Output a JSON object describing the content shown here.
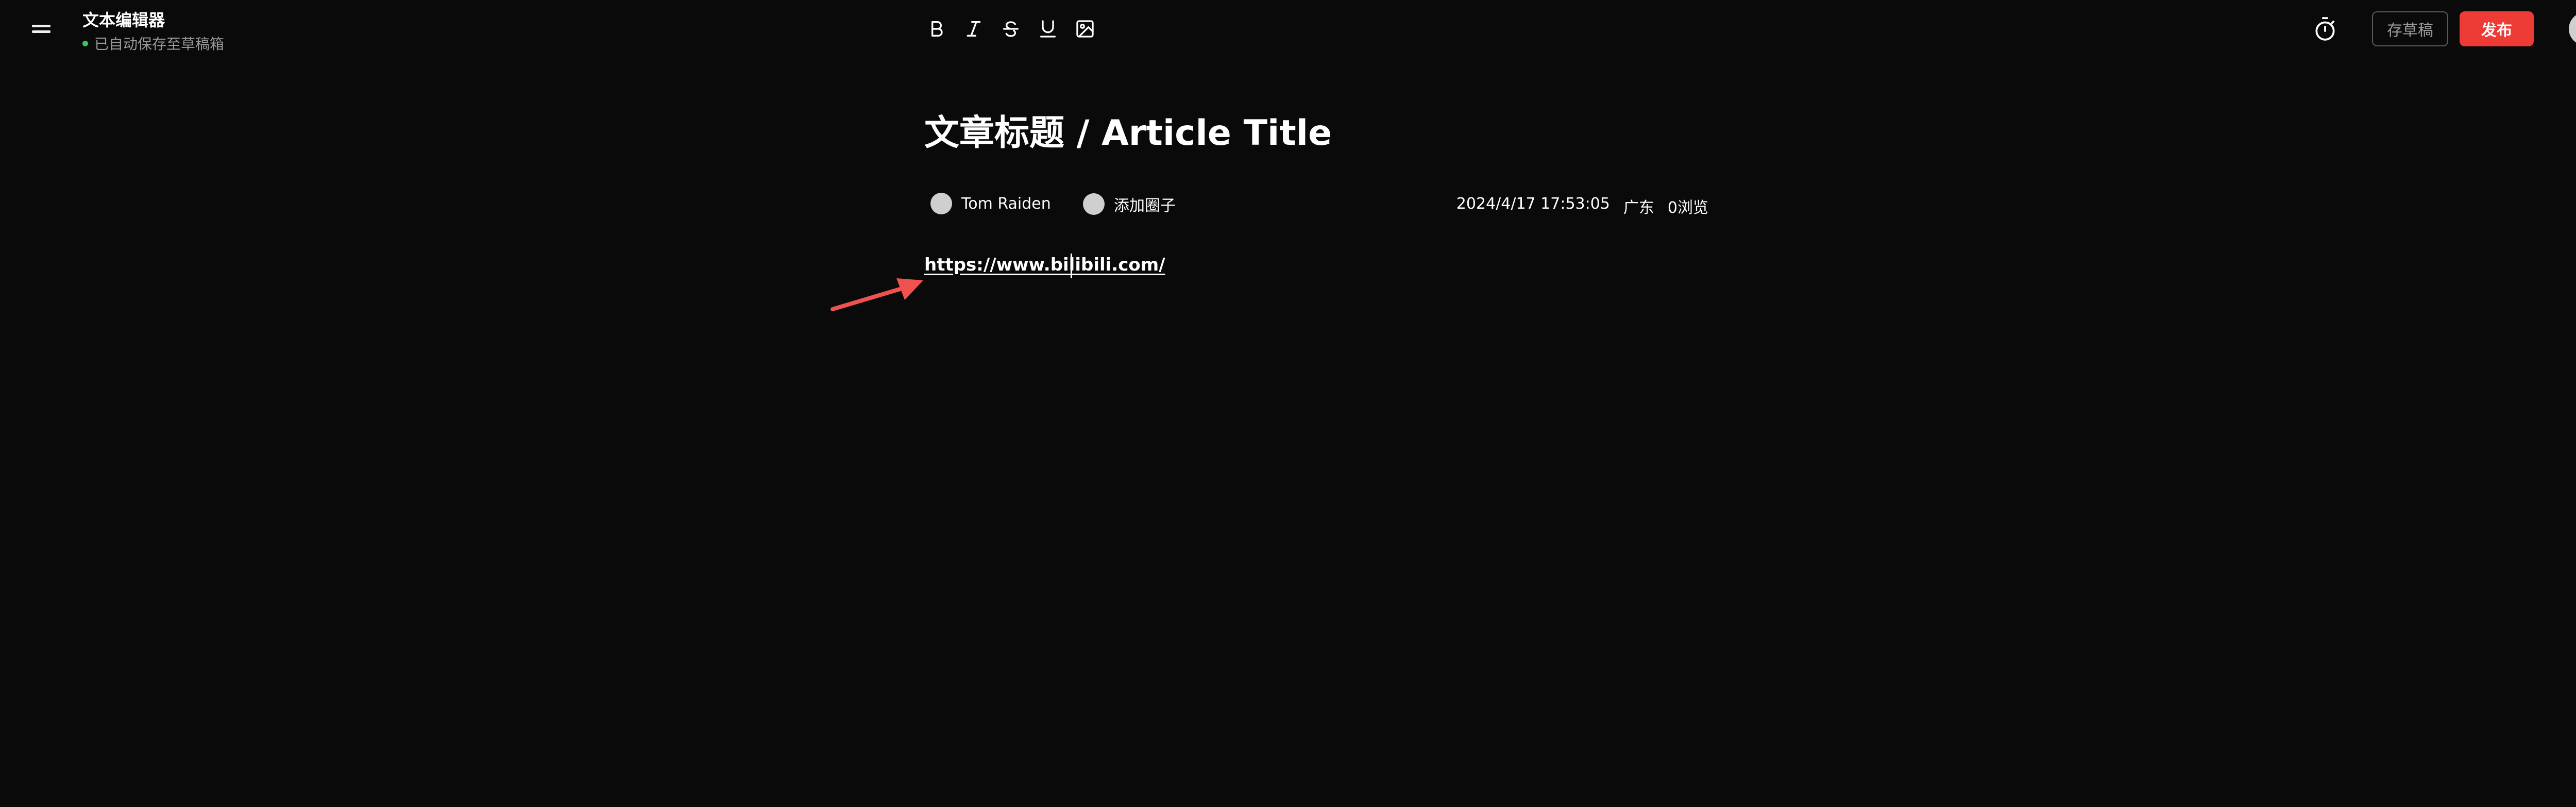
{
  "header": {
    "app_title": "文本编辑器",
    "save_status": "已自动保存至草稿箱",
    "status_color": "#34c759"
  },
  "toolbar": {
    "items": [
      {
        "name": "bold",
        "icon": "bold-icon"
      },
      {
        "name": "italic",
        "icon": "italic-icon"
      },
      {
        "name": "strikethrough",
        "icon": "strikethrough-icon"
      },
      {
        "name": "underline",
        "icon": "underline-icon"
      },
      {
        "name": "image",
        "icon": "image-icon"
      }
    ]
  },
  "actions": {
    "timer_icon": "stopwatch-icon",
    "draft_label": "存草稿",
    "publish_label": "发布",
    "publish_color": "#ef3b36"
  },
  "article": {
    "title": "文章标题 / Article Title",
    "author": "Tom Raiden",
    "circle_label": "添加圈子",
    "datetime": "2024/4/17 17:53:05",
    "location": "广东",
    "views": "0浏览",
    "content_link": "https://www.bilibili.com/"
  },
  "annotation": {
    "arrow_color": "#f0524f"
  }
}
